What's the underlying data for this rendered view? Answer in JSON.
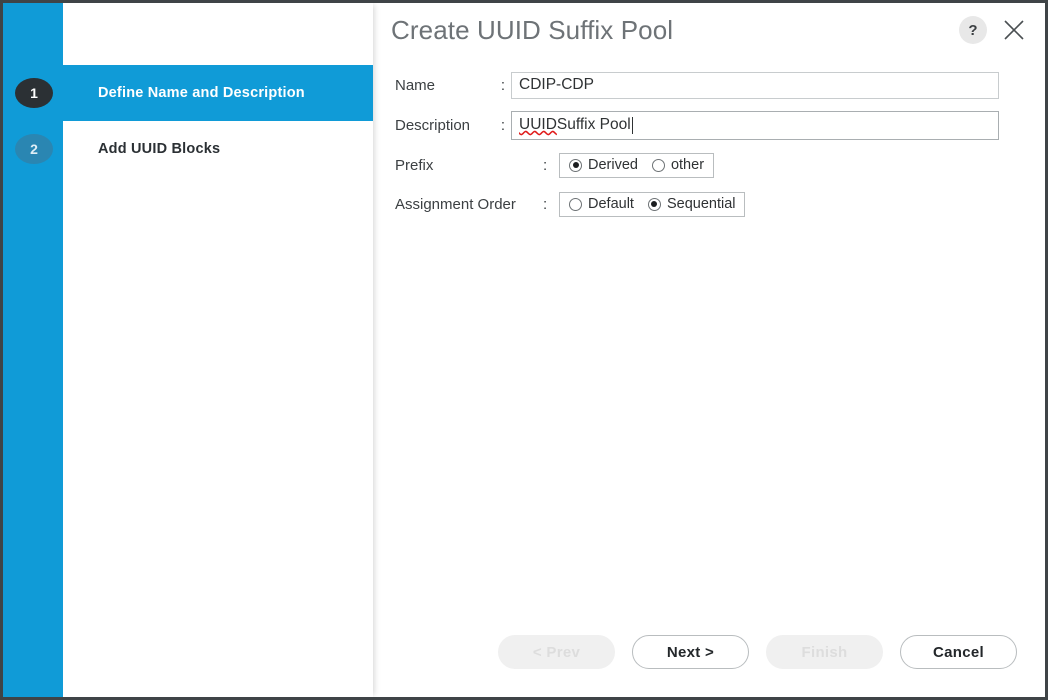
{
  "dialog": {
    "title": "Create UUID Suffix Pool",
    "help_icon": "question-mark-icon",
    "close_icon": "close-icon",
    "accent_color": "#109bd7",
    "current_step_color": "#2b3034"
  },
  "wizard": {
    "steps": [
      {
        "number": "1",
        "label": "Define Name and Description",
        "state": "current"
      },
      {
        "number": "2",
        "label": "Add UUID Blocks",
        "state": "upcoming"
      }
    ]
  },
  "form": {
    "name": {
      "label": "Name",
      "separator": ":",
      "value": "CDIP-CDP",
      "placeholder": ""
    },
    "description": {
      "label": "Description",
      "separator": ":",
      "value_misspelled": "UUID",
      "value_rest": " Suffix Pool",
      "placeholder": ""
    },
    "prefix": {
      "label": "Prefix",
      "separator": ":",
      "options": [
        {
          "label": "Derived",
          "selected": true
        },
        {
          "label": "other",
          "selected": false
        }
      ]
    },
    "assignment_order": {
      "label": "Assignment Order",
      "separator": ":",
      "options": [
        {
          "label": "Default",
          "selected": false
        },
        {
          "label": "Sequential",
          "selected": true
        }
      ]
    }
  },
  "footer": {
    "prev_label": "< Prev",
    "next_label": "Next >",
    "finish_label": "Finish",
    "cancel_label": "Cancel"
  }
}
